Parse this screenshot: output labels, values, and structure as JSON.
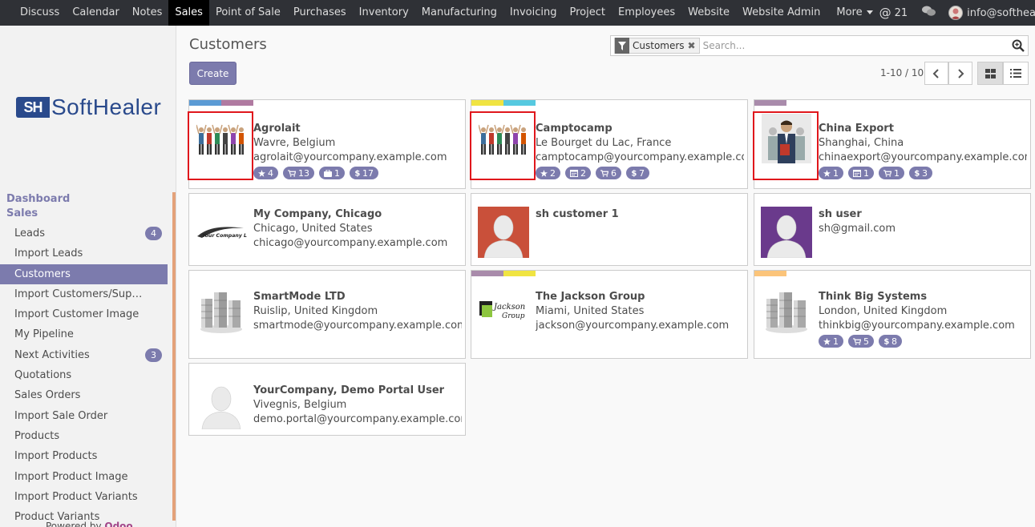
{
  "topnav": {
    "menus": [
      "Discuss",
      "Calendar",
      "Notes",
      "Sales",
      "Point of Sale",
      "Purchases",
      "Inventory",
      "Manufacturing",
      "Invoicing",
      "Project",
      "Employees",
      "Website",
      "Website Admin"
    ],
    "active_menu": "Sales",
    "more_label": "More",
    "mentions_count": "21",
    "user_email": "info@softhealer.com"
  },
  "brand": {
    "mark": "SH",
    "name": "SoftHealer"
  },
  "sidebar": {
    "section_dashboard": "Dashboard",
    "section_sales": "Sales",
    "items": [
      {
        "label": "Leads",
        "badge": "4"
      },
      {
        "label": "Import Leads",
        "badge": ""
      },
      {
        "label": "Customers",
        "badge": "",
        "active": true
      },
      {
        "label": "Import Customers/Suppli…",
        "badge": ""
      },
      {
        "label": "Import Customer Image",
        "badge": ""
      },
      {
        "label": "My Pipeline",
        "badge": ""
      },
      {
        "label": "Next Activities",
        "badge": "3"
      },
      {
        "label": "Quotations",
        "badge": ""
      },
      {
        "label": "Sales Orders",
        "badge": ""
      },
      {
        "label": "Import Sale Order",
        "badge": ""
      },
      {
        "label": "Products",
        "badge": ""
      },
      {
        "label": "Import Products",
        "badge": ""
      },
      {
        "label": "Import Product Image",
        "badge": ""
      },
      {
        "label": "Import Product Variants",
        "badge": ""
      },
      {
        "label": "Product Variants",
        "badge": ""
      }
    ],
    "powered_prefix": "Powered by",
    "powered_brand": "Odoo"
  },
  "control": {
    "title": "Customers",
    "create_label": "Create",
    "facet_label": "Customers",
    "facet_remove": "✖",
    "search_placeholder": "Search...",
    "pager": "1-10 / 10"
  },
  "colors": {
    "accent": "#7c7bad",
    "highlight": "#e0171c",
    "topbar": "#2f3136"
  },
  "cards": [
    {
      "name": "Agrolait",
      "line1": "Wavre, Belgium",
      "line2": "agrolait@yourcompany.example.com",
      "image": "people-group",
      "tags": [
        "#5b9bd5",
        "#b07aa1"
      ],
      "pills": [
        {
          "icon": "star-icon",
          "value": "4"
        },
        {
          "icon": "cart-icon",
          "value": "13"
        },
        {
          "icon": "suitcase-icon",
          "value": "1"
        },
        {
          "icon": "dollar-icon",
          "value": "17"
        }
      ],
      "highlighted": true
    },
    {
      "name": "Camptocamp",
      "line1": "Le Bourget du Lac, France",
      "line2": "camptocamp@yourcompany.example.com",
      "image": "people-group",
      "tags": [
        "#f0e442",
        "#56c9e0"
      ],
      "pills": [
        {
          "icon": "star-icon",
          "value": "2"
        },
        {
          "icon": "calendar-icon",
          "value": "2"
        },
        {
          "icon": "cart-icon",
          "value": "6"
        },
        {
          "icon": "dollar-icon",
          "value": "7"
        }
      ],
      "highlighted": true
    },
    {
      "name": "China Export",
      "line1": "Shanghai, China",
      "line2": "chinaexport@yourcompany.example.com",
      "image": "businessman",
      "tags": [
        "#a98bab"
      ],
      "pills": [
        {
          "icon": "star-icon",
          "value": "1"
        },
        {
          "icon": "calendar-icon",
          "value": "1"
        },
        {
          "icon": "cart-icon",
          "value": "1"
        },
        {
          "icon": "dollar-icon",
          "value": "3"
        }
      ],
      "highlighted": true
    },
    {
      "name": "My Company, Chicago",
      "line1": "Chicago, United States",
      "line2": "chicago@yourcompany.example.com",
      "image": "company-logo",
      "logo_text": "Your Company Logo",
      "tags": [],
      "pills": []
    },
    {
      "name": "sh customer 1",
      "line1": "",
      "line2": "",
      "image": "avatar-red",
      "tags": [],
      "pills": []
    },
    {
      "name": "sh user",
      "line1": "sh@gmail.com",
      "line2": "",
      "image": "avatar-purple",
      "tags": [],
      "pills": []
    },
    {
      "name": "SmartMode LTD",
      "line1": "Ruislip, United Kingdom",
      "line2": "smartmode@yourcompany.example.com",
      "image": "buildings",
      "tags": [],
      "pills": []
    },
    {
      "name": "The Jackson Group",
      "line1": "Miami, United States",
      "line2": "jackson@yourcompany.example.com",
      "image": "jackson-logo",
      "logo_text": "Jackson Group",
      "tags": [
        "#a98bab",
        "#f0e442"
      ],
      "pills": []
    },
    {
      "name": "Think Big Systems",
      "line1": "London, United Kingdom",
      "line2": "thinkbig@yourcompany.example.com",
      "image": "buildings",
      "tags": [
        "#fbc47a"
      ],
      "pills": [
        {
          "icon": "star-icon",
          "value": "1"
        },
        {
          "icon": "cart-icon",
          "value": "5"
        },
        {
          "icon": "dollar-icon",
          "value": "8"
        }
      ]
    },
    {
      "name": "YourCompany, Demo Portal User",
      "line1": "Vivegnis, Belgium",
      "line2": "demo.portal@yourcompany.example.com",
      "image": "avatar-white",
      "tags": [],
      "pills": []
    }
  ]
}
